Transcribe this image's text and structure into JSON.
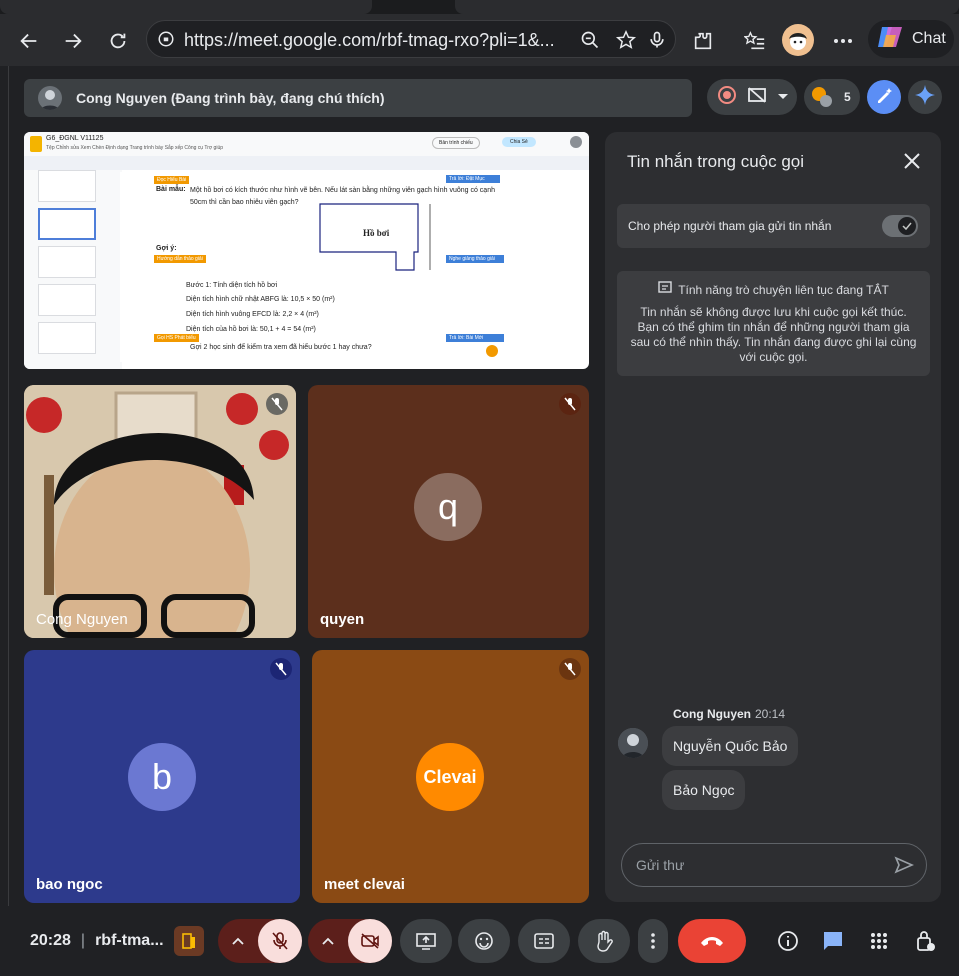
{
  "browser": {
    "url": "https://meet.google.com/rbf-tmag-rxo?pli=1&...",
    "chat_label": "Chat"
  },
  "header": {
    "presenter_text": "Cong Nguyen (Đang trình bày, đang chú thích)",
    "participant_count": "5"
  },
  "presentation": {
    "doc_title": "G6_ĐGNL V11125",
    "slide_title": "Bài mẫu:",
    "slide_problem": "Một hồ bơi có kích thước như hình vẽ bên. Nếu lát sàn bằng những viên gạch hình vuông có cạnh 50cm thì cần bao nhiêu viên gạch?",
    "pool_label": "Hồ bơi",
    "hint_label": "Gợi ý:",
    "step1": "Bước 1: Tính diện tích hồ bơi",
    "line1": "Diện tích hình chữ nhật ABFG là: 10,5 × 50 (m²)",
    "line2": "Diện tích hình vuông EFCD là: 2,2 × 4 (m²)",
    "line3": "Diện tích của hồ bơi là: 50,1 + 4 = 54 (m²)",
    "question": "Gợi 2 học sinh để kiểm tra xem đã hiểu bước 1 hay chưa?",
    "share_button": "Chia Sẻ",
    "present_button": "Bản trình chiếu"
  },
  "tiles": [
    {
      "name": "Cong Nguyen"
    },
    {
      "name": "quyen",
      "initial": "q"
    },
    {
      "name": "bao ngoc",
      "initial": "b"
    },
    {
      "name": "meet clevai",
      "logo": "Clevai"
    }
  ],
  "panel": {
    "title": "Tin nhắn trong cuộc gọi",
    "allow_label": "Cho phép người tham gia gửi tin nhắn",
    "info_head": "Tính năng trò chuyện liên tục đang TẮT",
    "info_body": "Tin nhắn sẽ không được lưu khi cuộc gọi kết thúc. Bạn có thể ghim tin nhắn để những người tham gia sau có thể nhìn thấy. Tin nhắn đang được ghi lại cùng với cuộc gọi.",
    "sender": "Cong Nguyen",
    "time": "20:14",
    "messages": [
      "Nguyễn Quốc Bảo",
      "Bảo Ngọc"
    ],
    "input_placeholder": "Gửi thư"
  },
  "bottom": {
    "time": "20:28",
    "meeting_code": "rbf-tma..."
  },
  "colors": {
    "end_call": "#ea4335",
    "muted_bg": "#f9dedc",
    "tile_quyen": "#5c2f1c",
    "tile_bao": "#2d3a8c",
    "tile_clevai": "#8a4a14"
  }
}
